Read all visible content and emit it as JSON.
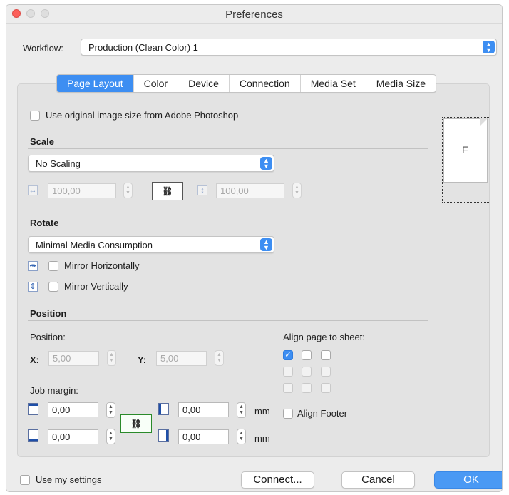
{
  "window": {
    "title": "Preferences"
  },
  "workflow": {
    "label": "Workflow:",
    "value": "Production (Clean Color) 1"
  },
  "tabs": [
    {
      "label": "Page Layout",
      "active": true
    },
    {
      "label": "Color"
    },
    {
      "label": "Device"
    },
    {
      "label": "Connection"
    },
    {
      "label": "Media Set"
    },
    {
      "label": "Media Size"
    }
  ],
  "original_size": {
    "label": "Use original image size from Adobe Photoshop",
    "checked": false
  },
  "scale": {
    "heading": "Scale",
    "mode": "No Scaling",
    "width_value": "100,00",
    "height_value": "100,00"
  },
  "rotate": {
    "heading": "Rotate",
    "mode": "Minimal Media Consumption",
    "mirror_h": "Mirror Horizontally",
    "mirror_v": "Mirror Vertically"
  },
  "position": {
    "heading": "Position",
    "position_label": "Position:",
    "x_label": "X:",
    "x_value": "5,00",
    "y_label": "Y:",
    "y_value": "5,00",
    "align_label": "Align page to sheet:",
    "align_checked_index": 0,
    "job_margin_label": "Job margin:",
    "margin_top": "0,00",
    "margin_bottom": "0,00",
    "margin_left": "0,00",
    "margin_right": "0,00",
    "unit": "mm",
    "align_footer": "Align Footer"
  },
  "preview": {
    "letter": "F"
  },
  "footer": {
    "use_my_settings": "Use my settings",
    "connect": "Connect...",
    "cancel": "Cancel",
    "ok": "OK"
  },
  "colors": {
    "accent": "#3d8ef2",
    "window_bg": "#ececec",
    "panel_bg": "#e3e3e3"
  }
}
